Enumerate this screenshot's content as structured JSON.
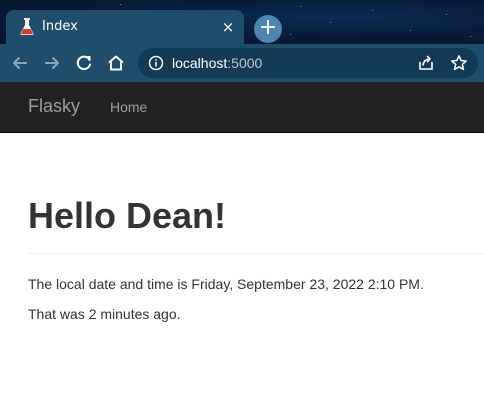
{
  "browser": {
    "tab_title": "Index",
    "tab_close_symbol": "×",
    "new_tab_symbol": "+",
    "url_host": "localhost",
    "url_port": ":5000",
    "icons": [
      "flask-icon",
      "close-icon",
      "plus-icon",
      "back-arrow-icon",
      "forward-arrow-icon",
      "reload-icon",
      "home-icon",
      "info-icon",
      "share-icon",
      "star-icon"
    ]
  },
  "navbar": {
    "brand": "Flasky",
    "items": [
      {
        "label": "Home"
      }
    ]
  },
  "main": {
    "heading": "Hello Dean!",
    "datetime_line": "The local date and time is Friday, September 23, 2022 2:10 PM.",
    "relative_line": "That was 2 minutes ago."
  },
  "colors": {
    "tab_active": "#1f4e6c",
    "toolbar": "#1f4e6c",
    "omnibox": "#123a55",
    "navbar_bg": "#222222",
    "navbar_text": "#9d9d9d",
    "body_text": "#333333"
  }
}
